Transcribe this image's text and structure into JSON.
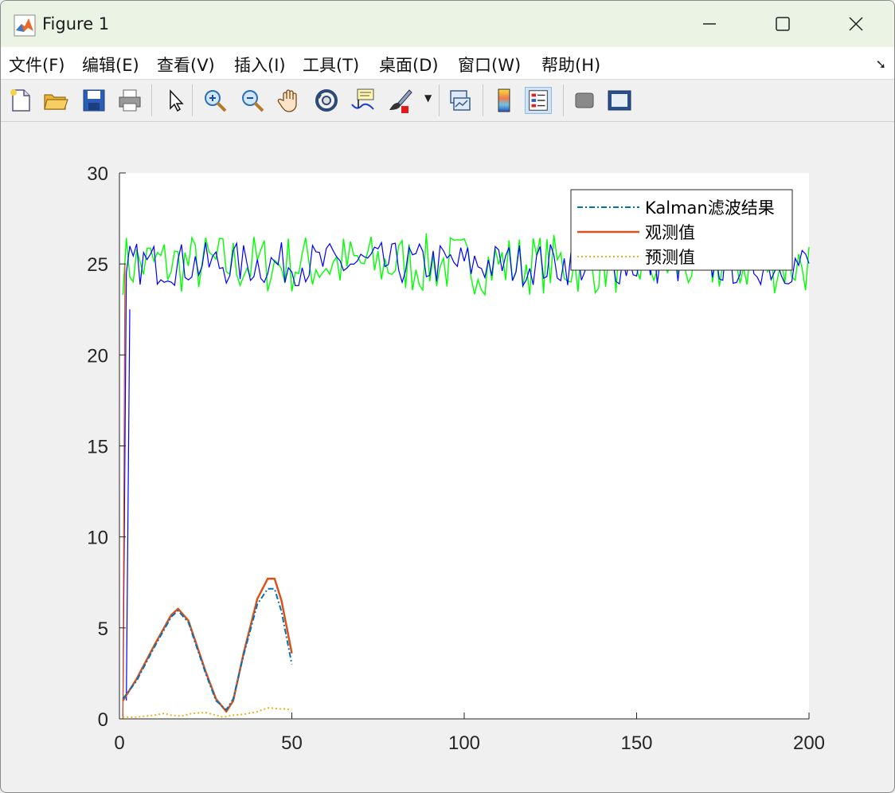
{
  "window": {
    "title": "Figure 1"
  },
  "menu": [
    "文件(F)",
    "编辑(E)",
    "查看(V)",
    "插入(I)",
    "工具(T)",
    "桌面(D)",
    "窗口(W)",
    "帮助(H)"
  ],
  "toolbar": [
    "new-figure",
    "open",
    "save",
    "print",
    "edit-plot",
    "zoom-in",
    "zoom-out",
    "pan",
    "rotate-3d",
    "data-cursor",
    "brush",
    "link-plot",
    "insert-colorbar",
    "insert-legend",
    "hide-plot-tools",
    "show-plot-tools"
  ],
  "colors": {
    "kalman": "#0072BD",
    "observed": "#D95319",
    "predicted": "#EDB120",
    "noisy_green": "#00FF00",
    "noisy_blue": "#0000FF"
  },
  "chart_data": {
    "type": "line",
    "xlim": [
      0,
      200
    ],
    "ylim": [
      0,
      30
    ],
    "xticks": [
      0,
      50,
      100,
      150,
      200
    ],
    "yticks": [
      0,
      5,
      10,
      15,
      20,
      25,
      30
    ],
    "legend": {
      "position": "top-right",
      "entries": [
        "Kalman滤波结果",
        "观测值",
        "预测值"
      ]
    },
    "series": [
      {
        "name": "Kalman滤波结果",
        "style": "dash-dot",
        "color": "#0072BD",
        "x": [
          1,
          5,
          10,
          15,
          17,
          20,
          25,
          28,
          31,
          33,
          36,
          40,
          43,
          45,
          47,
          50
        ],
        "y": [
          1.1,
          2.1,
          3.9,
          5.6,
          5.95,
          5.3,
          2.5,
          1.0,
          0.5,
          1.1,
          3.5,
          6.3,
          7.15,
          7.15,
          5.9,
          3.0
        ]
      },
      {
        "name": "观测值",
        "style": "solid",
        "color": "#D95319",
        "x": [
          1,
          5,
          10,
          15,
          17,
          20,
          25,
          28,
          31,
          33,
          36,
          40,
          43,
          45,
          47,
          50
        ],
        "y": [
          1.0,
          2.2,
          4.0,
          5.7,
          6.05,
          5.4,
          2.6,
          1.1,
          0.4,
          1.0,
          3.6,
          6.6,
          7.7,
          7.7,
          6.5,
          3.6
        ]
      },
      {
        "name": "预测值",
        "style": "dotted",
        "color": "#EDB120",
        "x": [
          1,
          5,
          10,
          13,
          15,
          18,
          21,
          25,
          28,
          30,
          33,
          36,
          40,
          43,
          44,
          46,
          48,
          50
        ],
        "y": [
          0.1,
          0.1,
          0.2,
          0.3,
          0.2,
          0.15,
          0.3,
          0.35,
          0.2,
          0.1,
          0.2,
          0.25,
          0.4,
          0.6,
          0.6,
          0.55,
          0.55,
          0.5
        ]
      }
    ]
  }
}
